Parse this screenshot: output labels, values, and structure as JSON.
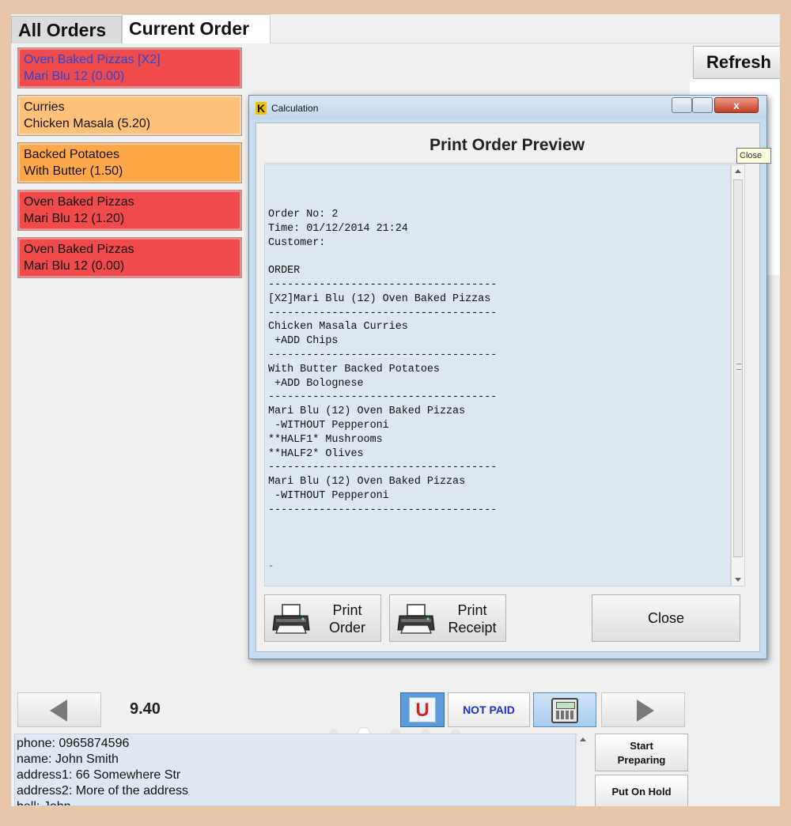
{
  "tabs": {
    "all_orders": "All Orders",
    "current_order": "Current Order"
  },
  "refresh_label": "Refresh",
  "order_items": [
    {
      "line1": "Oven Baked Pizzas [X2]",
      "line2": "Mari Blu 12 (0.00)",
      "bg": "#f04a4a",
      "text_color": "#2a48d8"
    },
    {
      "line1": "Curries",
      "line2": "Chicken Masala  (5.20)",
      "bg": "#ffc07a",
      "text_color": "#111111"
    },
    {
      "line1": "Backed Potatoes",
      "line2": "With Butter  (1.50)",
      "bg": "#ffa84a",
      "text_color": "#111111"
    },
    {
      "line1": "Oven Baked Pizzas",
      "line2": "Mari Blu 12 (1.20)",
      "bg": "#f04a4a",
      "text_color": "#111111"
    },
    {
      "line1": "Oven Baked Pizzas",
      "line2": "Mari Blu 12 (0.00)",
      "bg": "#f04a4a",
      "text_color": "#111111"
    }
  ],
  "total": "9.40",
  "u_label": "U",
  "not_paid_label": "NOT PAID",
  "customer": {
    "line1": "phone: 0965874596",
    "line2": "name: John Smith",
    "line3": "address1: 66 Somewhere Str",
    "line4": "address2: More of the address",
    "line5": "bell: John"
  },
  "buttons": {
    "start_line1": "Start",
    "start_line2": "Preparing",
    "hold": "Put On Hold"
  },
  "dialog": {
    "title": "Calculation",
    "close_x": "x",
    "tooltip": "Close",
    "header": "Print Order Preview",
    "receipt_text": "Order No: 2\nTime: 01/12/2014 21:24\nCustomer:\n\nORDER\n------------------------------------\n[X2]Mari Blu (12) Oven Baked Pizzas\n------------------------------------\nChicken Masala Curries\n +ADD Chips\n------------------------------------\nWith Butter Backed Potatoes\n +ADD Bolognese\n------------------------------------\nMari Blu (12) Oven Baked Pizzas\n -WITHOUT Pepperoni\n**HALF1* Mushrooms\n**HALF2* Olives\n------------------------------------\nMari Blu (12) Oven Baked Pizzas\n -WITHOUT Pepperoni\n------------------------------------",
    "end_mark": "-",
    "print_order_line1": "Print",
    "print_order_line2": "Order",
    "print_receipt_line1": "Print",
    "print_receipt_line2": "Receipt",
    "close_label": "Close"
  },
  "icons": [
    "printer-icon",
    "calculator-icon",
    "arrow-left-icon",
    "arrow-right-icon",
    "k-app-icon"
  ]
}
